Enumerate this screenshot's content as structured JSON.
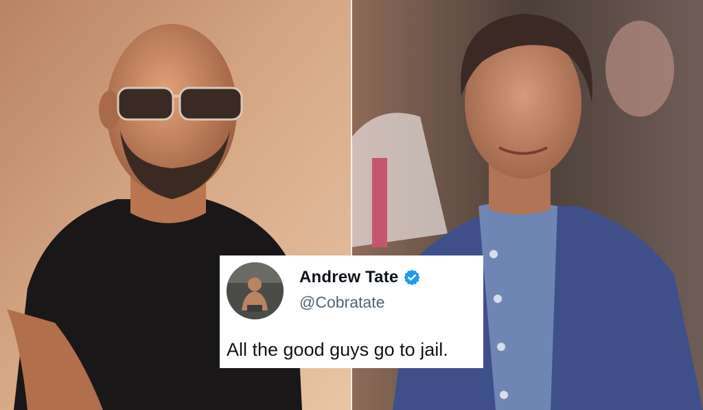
{
  "tweet": {
    "name": "Andrew Tate",
    "handle": "@Cobratate",
    "text": "All the good guys go to jail.",
    "verified": true,
    "verified_color": "#1d9bf0"
  },
  "images": {
    "left": "photo-man-sunglasses-black-tshirt",
    "right": "photo-man-blue-suit"
  }
}
